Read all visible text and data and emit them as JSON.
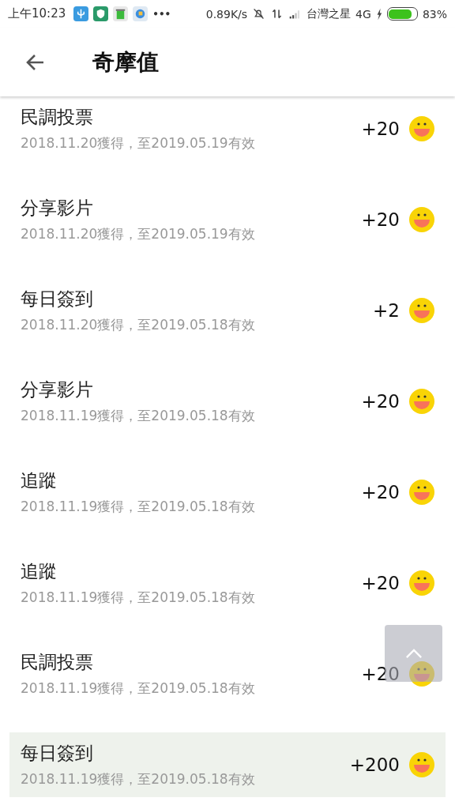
{
  "status_bar": {
    "time": "上午10:23",
    "more": "•••",
    "speed": "0.89K/s",
    "carrier": "台灣之星",
    "network": "4G",
    "battery": {
      "level": 0.83,
      "text": "83%"
    }
  },
  "header": {
    "title": "奇摩值"
  },
  "records": [
    {
      "title": "民調投票",
      "detail": "2018.11.20獲得，至2019.05.19有效",
      "points": "+20",
      "selected": false
    },
    {
      "title": "分享影片",
      "detail": "2018.11.20獲得，至2019.05.19有效",
      "points": "+20",
      "selected": false
    },
    {
      "title": "每日簽到",
      "detail": "2018.11.20獲得，至2019.05.18有效",
      "points": "+2",
      "selected": false
    },
    {
      "title": "分享影片",
      "detail": "2018.11.19獲得，至2019.05.18有效",
      "points": "+20",
      "selected": false
    },
    {
      "title": "追蹤",
      "detail": "2018.11.19獲得，至2019.05.18有效",
      "points": "+20",
      "selected": false
    },
    {
      "title": "追蹤",
      "detail": "2018.11.19獲得，至2019.05.18有效",
      "points": "+20",
      "selected": false
    },
    {
      "title": "民調投票",
      "detail": "2018.11.19獲得，至2019.05.18有效",
      "points": "+20",
      "selected": false
    },
    {
      "title": "每日簽到",
      "detail": "2018.11.19獲得，至2019.05.18有效",
      "points": "+200",
      "selected": true
    }
  ]
}
